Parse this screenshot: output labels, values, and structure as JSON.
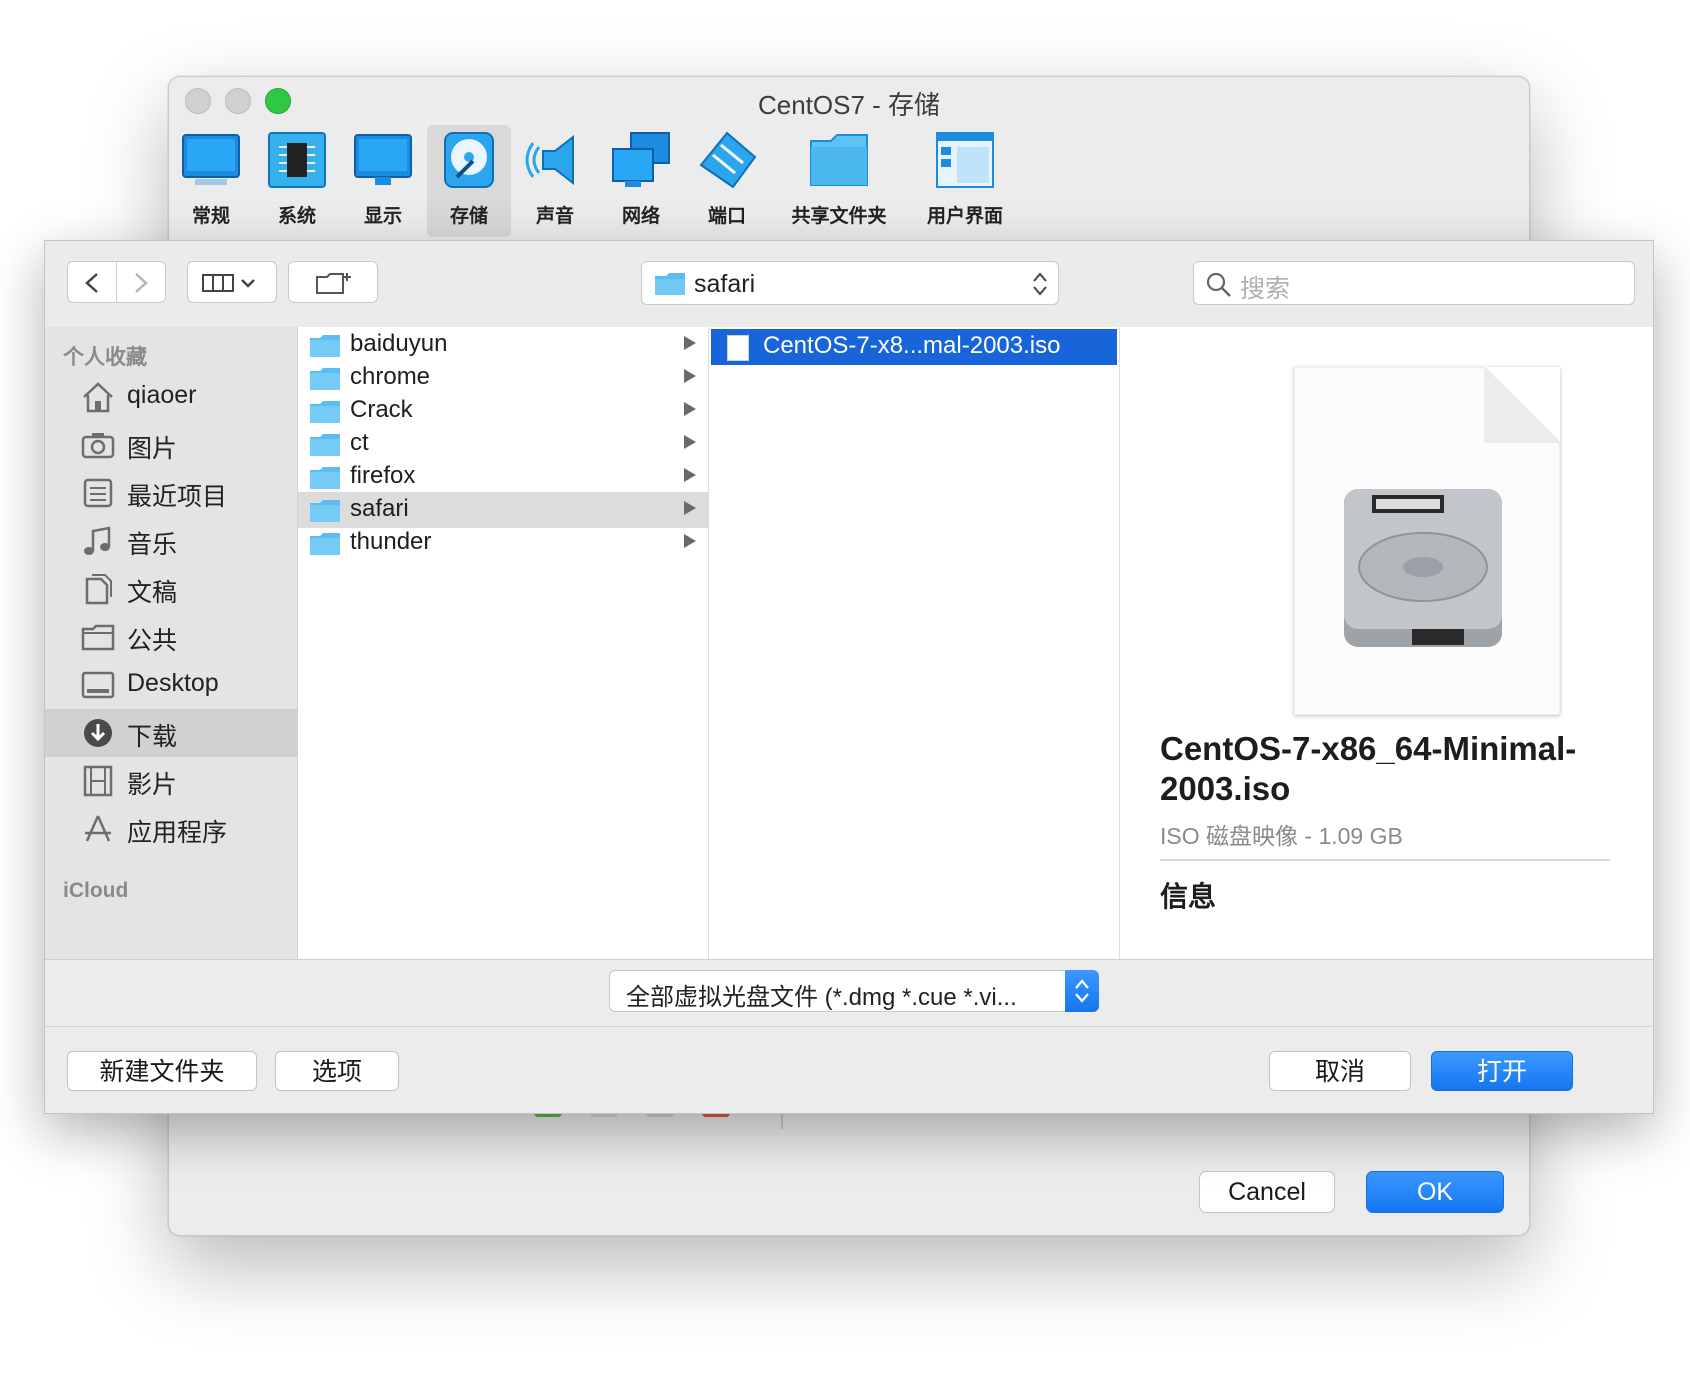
{
  "settings_window": {
    "title": "CentOS7 - 存储",
    "toolbar": [
      {
        "label": "常规",
        "icon": "general-monitor-icon"
      },
      {
        "label": "系统",
        "icon": "system-chip-icon"
      },
      {
        "label": "显示",
        "icon": "display-monitor-icon"
      },
      {
        "label": "存储",
        "icon": "storage-disk-icon",
        "active": true
      },
      {
        "label": "声音",
        "icon": "speaker-icon"
      },
      {
        "label": "网络",
        "icon": "network-icon"
      },
      {
        "label": "端口",
        "icon": "serial-port-icon"
      },
      {
        "label": "共享文件夹",
        "icon": "shared-folder-icon"
      },
      {
        "label": "用户界面",
        "icon": "user-interface-icon"
      }
    ],
    "cancel_label": "Cancel",
    "ok_label": "OK"
  },
  "dialog": {
    "path": "safari",
    "search_placeholder": "搜索",
    "sidebar": {
      "favorites_heading": "个人收藏",
      "items": [
        {
          "label": "qiaoer",
          "icon": "home-icon"
        },
        {
          "label": "图片",
          "icon": "camera-icon"
        },
        {
          "label": "最近项目",
          "icon": "recents-icon"
        },
        {
          "label": "音乐",
          "icon": "music-note-icon"
        },
        {
          "label": "文稿",
          "icon": "documents-icon"
        },
        {
          "label": "公共",
          "icon": "folder-icon"
        },
        {
          "label": "Desktop",
          "icon": "desktop-icon"
        },
        {
          "label": "下载",
          "icon": "download-icon",
          "selected": true
        },
        {
          "label": "影片",
          "icon": "film-icon"
        },
        {
          "label": "应用程序",
          "icon": "applications-icon"
        }
      ],
      "icloud_heading": "iCloud"
    },
    "column1": [
      "baiduyun",
      "chrome",
      "Crack",
      "ct",
      "firefox",
      "safari",
      "thunder"
    ],
    "column1_selected": "safari",
    "column2_file": "CentOS-7-x8...mal-2003.iso",
    "preview": {
      "name": "CentOS-7-x86_64-Minimal-2003.iso",
      "kind": "ISO 磁盘映像 - 1.09 GB",
      "info_heading": "信息"
    },
    "filter": "全部虚拟光盘文件 (*.dmg *.cue *.vi...",
    "buttons": {
      "new_folder": "新建文件夹",
      "options": "选项",
      "cancel": "取消",
      "open": "打开"
    }
  },
  "colors": {
    "accent": "#1765d8",
    "zoom_green": "#2ec845"
  }
}
